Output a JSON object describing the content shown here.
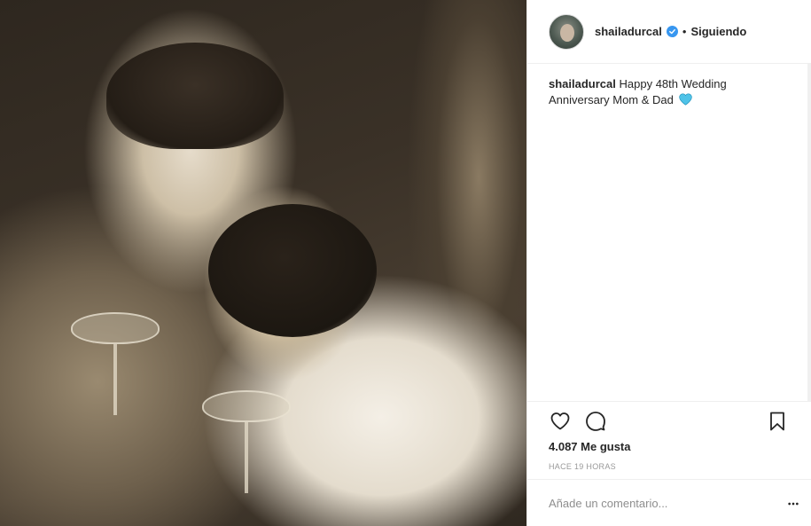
{
  "post": {
    "image_alt": "",
    "icon": "photo"
  },
  "header": {
    "avatar_icon": "profile-avatar",
    "username": "shailadurcal",
    "verified_icon": "verified-badge-icon",
    "separator": "•",
    "follow_label": "Siguiendo"
  },
  "caption": {
    "username": "shailadurcal",
    "text": "Happy 48th Wedding Anniversary Mom & Dad",
    "emoji_icon": "blue-heart-icon",
    "emoji_color": "#4fc3e8"
  },
  "actions": {
    "like_icon": "heart-icon",
    "comment_icon": "comment-icon",
    "save_icon": "bookmark-icon"
  },
  "likes": {
    "label": "4.087 Me gusta"
  },
  "timestamp": "Hace 19 horas",
  "comment": {
    "placeholder": "Añade un comentario...",
    "more_icon": "more-options-icon"
  },
  "colors": {
    "verified": "#3897f0",
    "text": "#262626",
    "muted": "#999999",
    "border": "#efefef"
  }
}
